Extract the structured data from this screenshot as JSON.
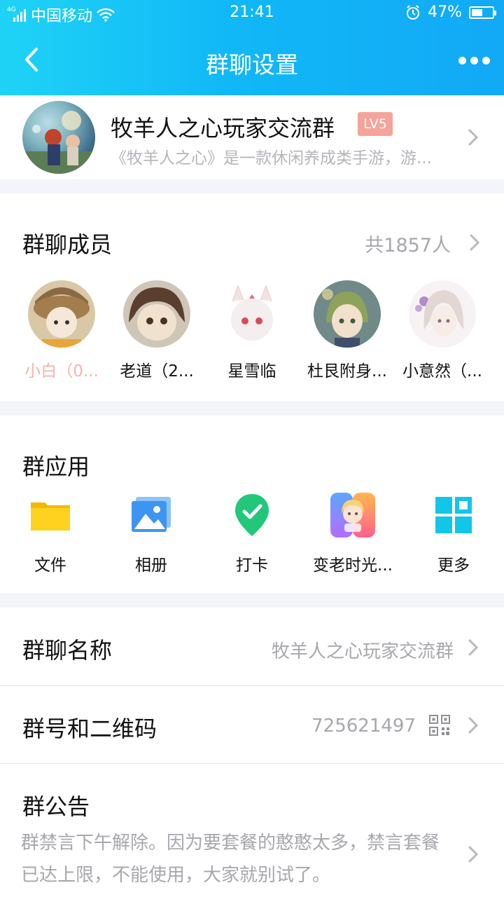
{
  "status_bar": {
    "network_type": "4G",
    "carrier": "中国移动",
    "time": "21:41",
    "battery_percent": "47%",
    "battery_level": 0.47,
    "icons": [
      "signal-icon",
      "wifi-icon",
      "alarm-icon",
      "battery-icon"
    ]
  },
  "navbar": {
    "title": "群聊设置",
    "back_icon": "chevron-left-icon",
    "more_icon": "more-dots-icon"
  },
  "group": {
    "name": "牧羊人之心玩家交流群",
    "level_badge": "LV5",
    "description": "《牧羊人之心》是一款休闲养成类手游，游..."
  },
  "members": {
    "title": "群聊成员",
    "count_text": "共1857人",
    "items": [
      {
        "name": "小白（0...",
        "color": "#f5b4a9"
      },
      {
        "name": "老道（2...",
        "color": "#111111"
      },
      {
        "name": "星雪临",
        "color": "#111111"
      },
      {
        "name": "杜艮附身...",
        "color": "#111111"
      },
      {
        "name": "小意然（...",
        "color": "#111111"
      }
    ]
  },
  "apps": {
    "title": "群应用",
    "items": [
      {
        "label": "文件",
        "icon": "folder-icon"
      },
      {
        "label": "相册",
        "icon": "photo-album-icon"
      },
      {
        "label": "打卡",
        "icon": "check-in-pin-icon"
      },
      {
        "label": "变老时光...",
        "icon": "aging-face-icon"
      },
      {
        "label": "更多",
        "icon": "more-grid-icon"
      }
    ]
  },
  "settings": {
    "group_name": {
      "label": "群聊名称",
      "value": "牧羊人之心玩家交流群"
    },
    "group_id": {
      "label": "群号和二维码",
      "value": "725621497",
      "icon": "qr-code-icon"
    },
    "notice": {
      "label": "群公告",
      "text": "群禁言下午解除。因为要套餐的憨憨太多，禁言套餐已达上限，不能使用，大家就别试了。"
    }
  },
  "colors": {
    "header_gradient_start": "#1fd3f6",
    "header_gradient_end": "#12a9f6",
    "secondary_text": "#a7a7ad",
    "badge": "#f5a49b",
    "page_background": "#f4f5f9"
  }
}
